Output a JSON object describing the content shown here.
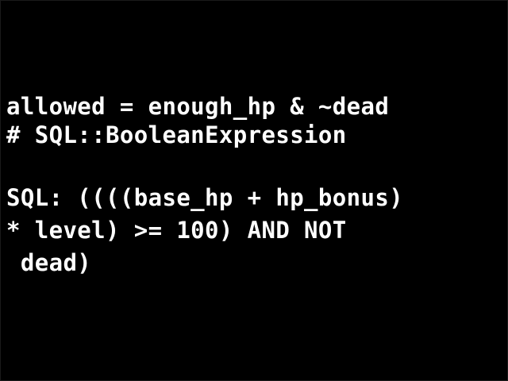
{
  "console": {
    "lines": [
      "allowed = enough_hp & ~dead",
      "# SQL::BooleanExpression",
      "SQL: ((((base_hp + hp_bonus)",
      "* level) >= 100) AND NOT",
      " dead)"
    ]
  },
  "colors": {
    "background": "#000000",
    "text": "#ffffff"
  }
}
